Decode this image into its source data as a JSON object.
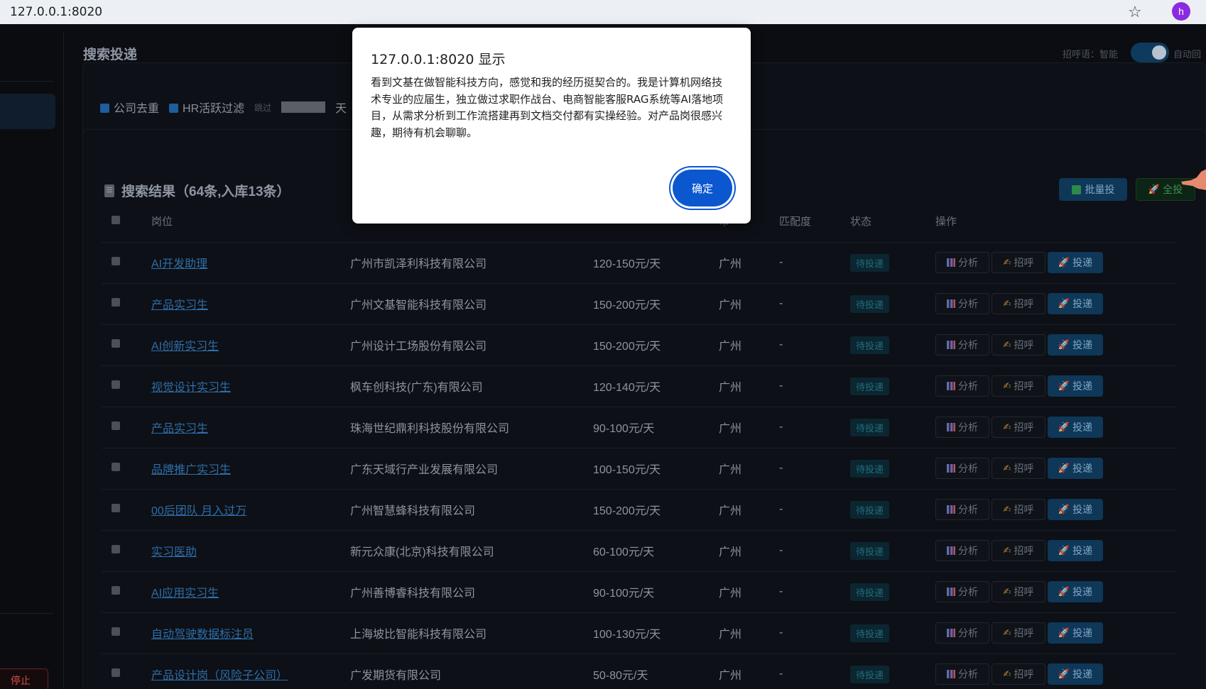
{
  "browser": {
    "url": "127.0.0.1:8020",
    "avatar_letter": "h"
  },
  "topbar": {
    "title": "搜索投递",
    "greet_label": "招呼语：智能",
    "auto_label": "自动回"
  },
  "filters": {
    "company_dedup": "公司去重",
    "hr_active_filter": "HR活跃过滤",
    "skip_label": "跳过",
    "skip_suffix": "天"
  },
  "sidebar": {
    "stop_label": "停止"
  },
  "results": {
    "heading": "搜索结果（64条,入库13条）",
    "batch_btn": "批量投",
    "all_btn": "全投",
    "columns": [
      "岗位",
      "",
      "",
      "市",
      "匹配度",
      "状态",
      "操作"
    ],
    "op_labels": {
      "analyze": "分析",
      "greet": "招呼",
      "send": "投递"
    },
    "rows": [
      {
        "position": "AI开发助理",
        "company": "广州市凯泽利科技有限公司",
        "salary": "120-150元/天",
        "city": "广州",
        "match": "-",
        "status": "待投递"
      },
      {
        "position": "产品实习生",
        "company": "广州文基智能科技有限公司",
        "salary": "150-200元/天",
        "city": "广州",
        "match": "-",
        "status": "待投递"
      },
      {
        "position": "AI创新实习生",
        "company": "广州设计工场股份有限公司",
        "salary": "150-200元/天",
        "city": "广州",
        "match": "-",
        "status": "待投递"
      },
      {
        "position": "视觉设计实习生",
        "company": "枫车创科技(广东)有限公司",
        "salary": "120-140元/天",
        "city": "广州",
        "match": "-",
        "status": "待投递"
      },
      {
        "position": "产品实习生",
        "company": "珠海世纪鼎利科技股份有限公司",
        "salary": "90-100元/天",
        "city": "广州",
        "match": "-",
        "status": "待投递"
      },
      {
        "position": "品牌推广实习生",
        "company": "广东天域行产业发展有限公司",
        "salary": "100-150元/天",
        "city": "广州",
        "match": "-",
        "status": "待投递"
      },
      {
        "position": "00后团队 月入过万",
        "company": "广州智慧蜂科技有限公司",
        "salary": "150-200元/天",
        "city": "广州",
        "match": "-",
        "status": "待投递"
      },
      {
        "position": "实习医助",
        "company": "新元众康(北京)科技有限公司",
        "salary": "60-100元/天",
        "city": "广州",
        "match": "-",
        "status": "待投递"
      },
      {
        "position": "AI应用实习生",
        "company": "广州善博睿科技有限公司",
        "salary": "90-100元/天",
        "city": "广州",
        "match": "-",
        "status": "待投递"
      },
      {
        "position": "自动驾驶数据标注员",
        "company": "上海坡比智能科技有限公司",
        "salary": "100-130元/天",
        "city": "广州",
        "match": "-",
        "status": "待投递"
      },
      {
        "position": "产品设计岗（风险子公司）",
        "company": "广发期货有限公司",
        "salary": "50-80元/天",
        "city": "广州",
        "match": "-",
        "status": "待投递"
      }
    ]
  },
  "dialog": {
    "title": "127.0.0.1:8020 显示",
    "message": "看到文基在做智能科技方向，感觉和我的经历挺契合的。我是计算机网络技术专业的应届生，独立做过求职作战台、电商智能客服RAG系统等AI落地项目，从需求分析到工作流搭建再到文档交付都有实操经验。对产品岗很感兴趣，期待有机会聊聊。",
    "ok_label": "确定"
  },
  "colors": {
    "accent_blue": "#0b57d0",
    "page_bg": "#0b0d12",
    "link": "#2e6ea9"
  }
}
